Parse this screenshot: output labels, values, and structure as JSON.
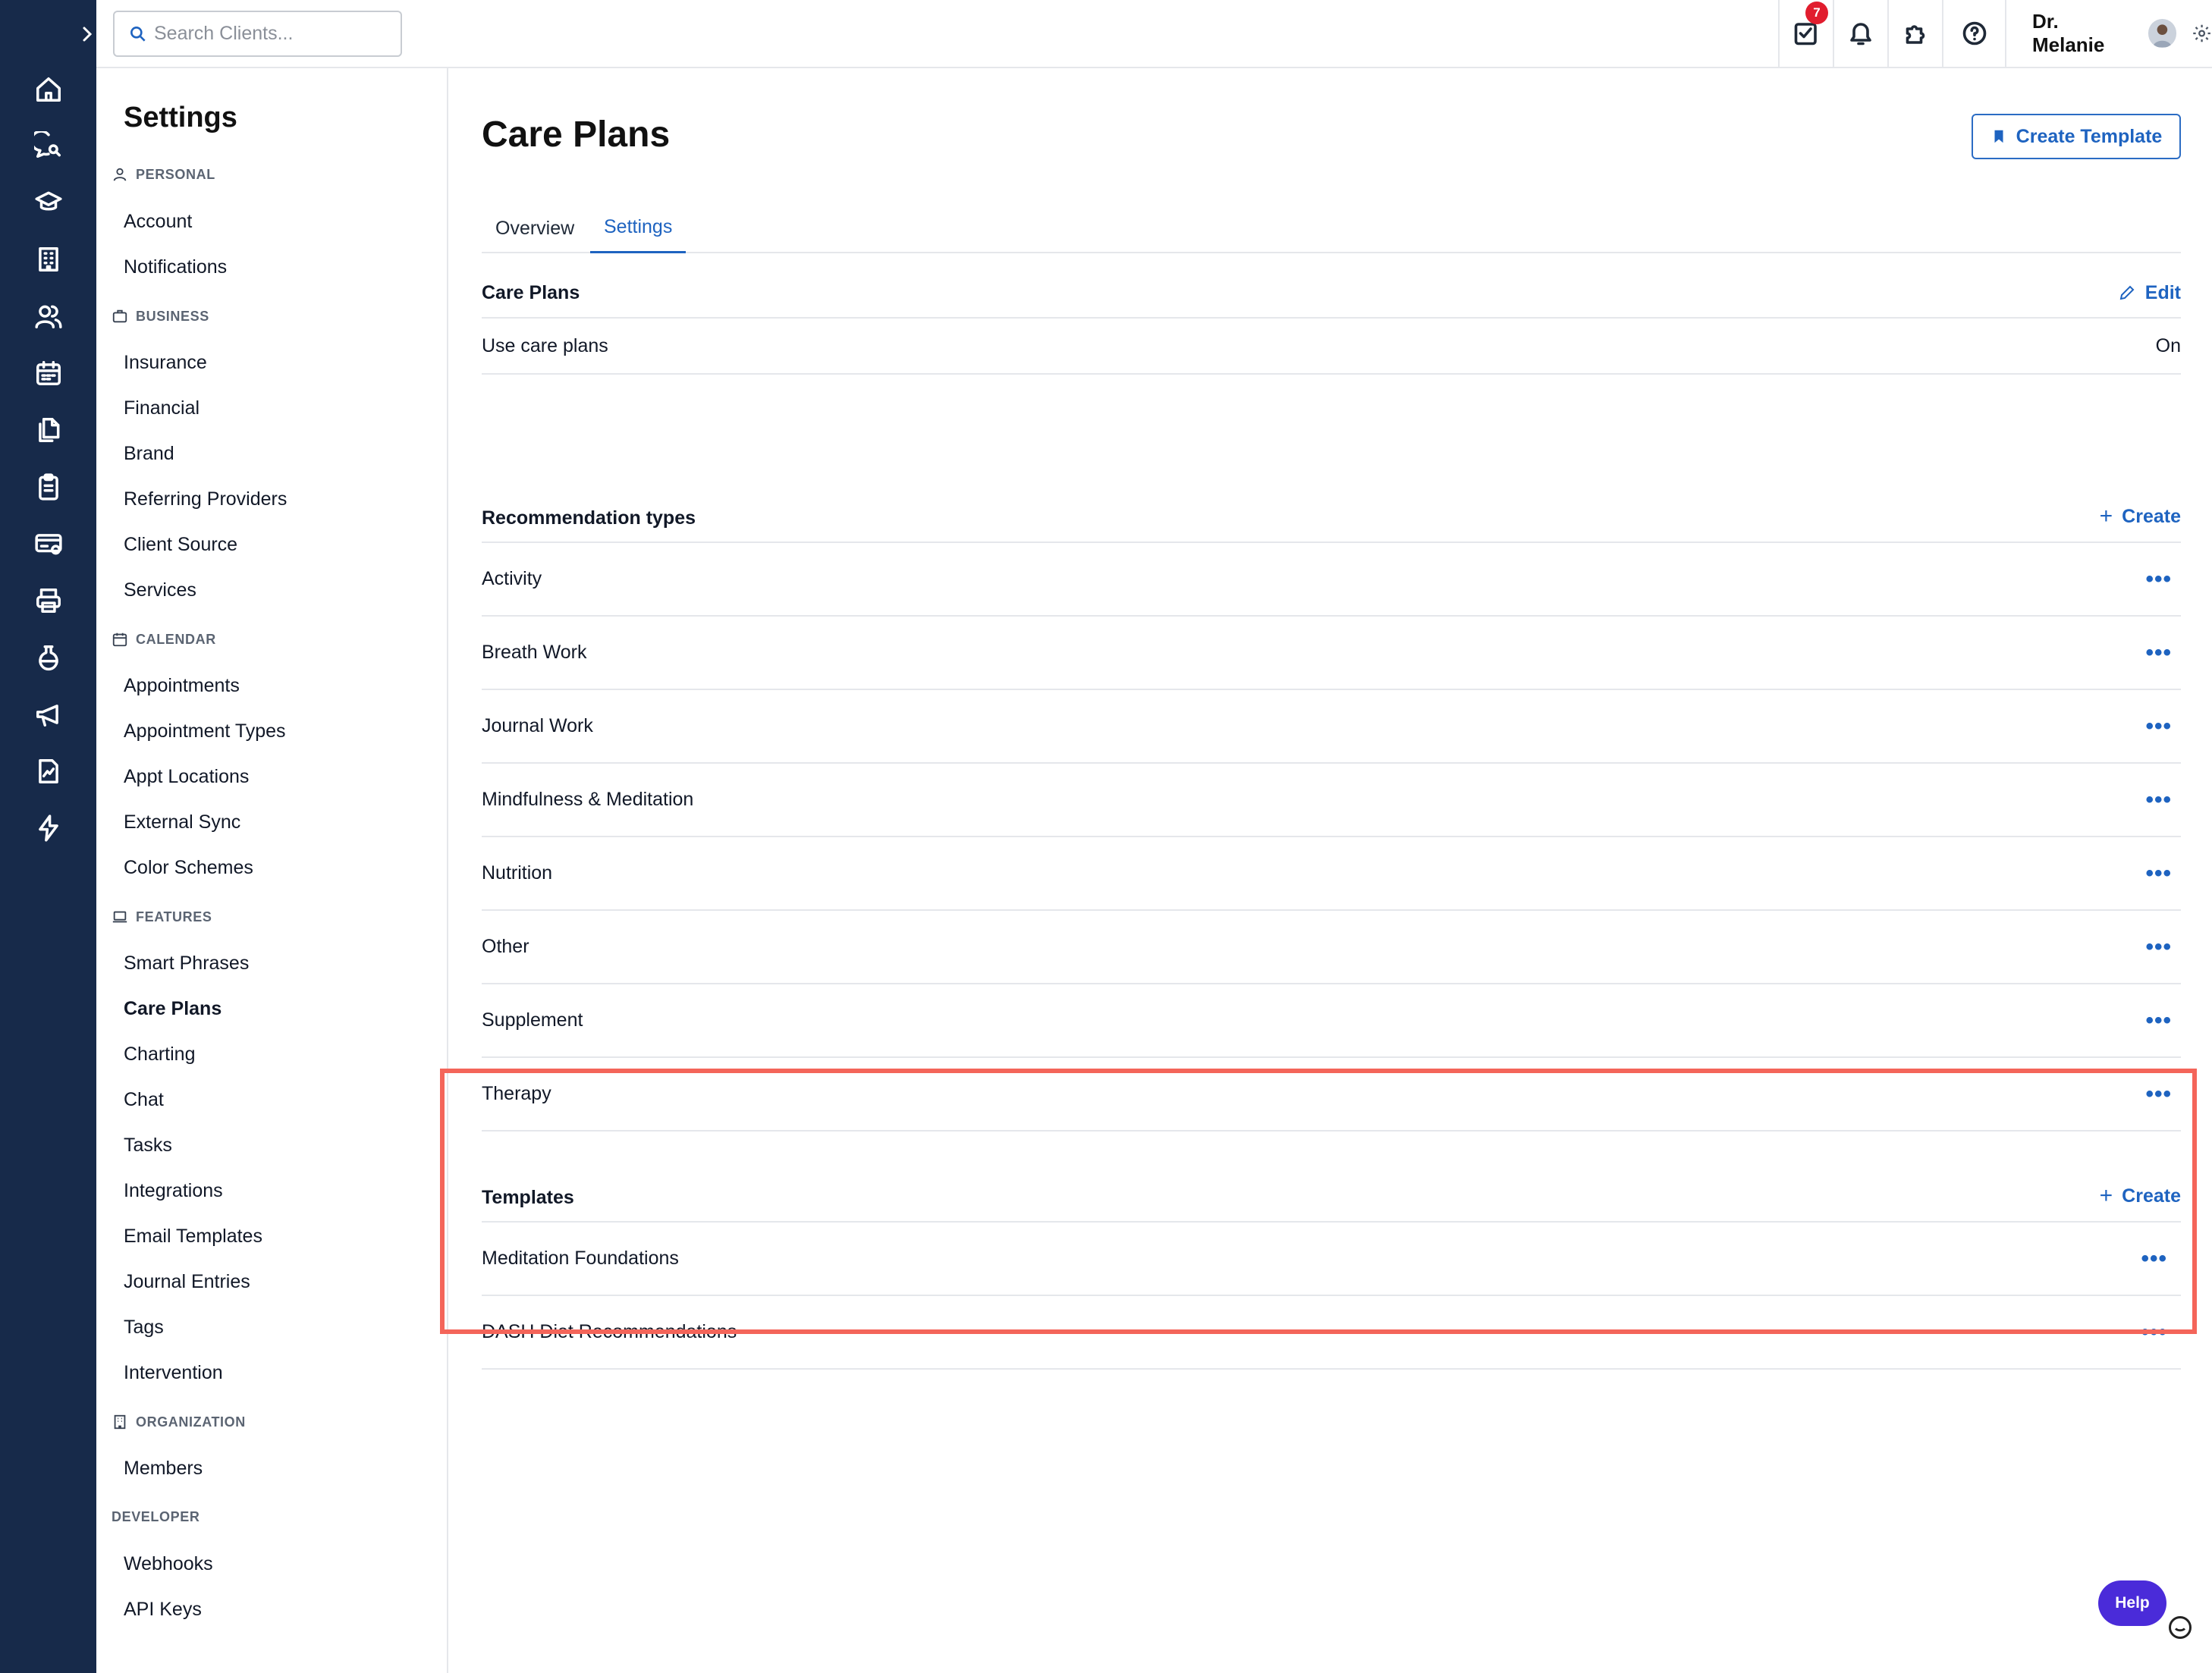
{
  "search": {
    "placeholder": "Search Clients..."
  },
  "topbar": {
    "task_badge": "7",
    "user_name": "Dr. Melanie"
  },
  "rail_icons": [
    "home-icon",
    "chat-search-icon",
    "graduation-cap-icon",
    "building-icon",
    "users-icon",
    "calendar-icon",
    "documents-icon",
    "clipboard-icon",
    "billing-icon",
    "printer-icon",
    "flask-icon",
    "megaphone-icon",
    "report-icon",
    "lightning-icon"
  ],
  "settings_nav": {
    "title": "Settings",
    "sections": {
      "personal": "PERSONAL",
      "business": "BUSINESS",
      "calendar": "CALENDAR",
      "features": "FEATURES",
      "organization": "ORGANIZATION",
      "developer": "DEVELOPER"
    },
    "items": {
      "account": "Account",
      "notifications": "Notifications",
      "insurance": "Insurance",
      "financial": "Financial",
      "brand": "Brand",
      "referring_providers": "Referring Providers",
      "client_source": "Client Source",
      "services": "Services",
      "appointments": "Appointments",
      "appointment_types": "Appointment Types",
      "appt_locations": "Appt Locations",
      "external_sync": "External Sync",
      "color_schemes": "Color Schemes",
      "smart_phrases": "Smart Phrases",
      "care_plans": "Care Plans",
      "charting": "Charting",
      "chat": "Chat",
      "tasks": "Tasks",
      "integrations": "Integrations",
      "email_templates": "Email Templates",
      "journal_entries": "Journal Entries",
      "tags": "Tags",
      "intervention": "Intervention",
      "members": "Members",
      "webhooks": "Webhooks",
      "api_keys": "API Keys"
    }
  },
  "main": {
    "title": "Care Plans",
    "create_template_label": "Create Template",
    "tabs": [
      "Overview",
      "Settings"
    ],
    "care_plans_section": {
      "heading": "Care Plans",
      "edit_label": "Edit",
      "setting_label": "Use care plans",
      "setting_value": "On"
    },
    "recommendation_types": {
      "heading": "Recommendation types",
      "create_label": "Create",
      "items": [
        "Activity",
        "Breath Work",
        "Journal Work",
        "Mindfulness & Meditation",
        "Nutrition",
        "Other",
        "Supplement",
        "Therapy"
      ]
    },
    "templates": {
      "heading": "Templates",
      "create_label": "Create",
      "items": [
        "Meditation Foundations",
        "DASH Diet Recommendations"
      ]
    },
    "more_glyph": "•••"
  },
  "help_label": "Help",
  "colors": {
    "rail": "#172a4a",
    "accent": "#1e63c0",
    "highlight": "#f4655a",
    "help": "#4a2bd9",
    "badge": "#e11d2e"
  }
}
